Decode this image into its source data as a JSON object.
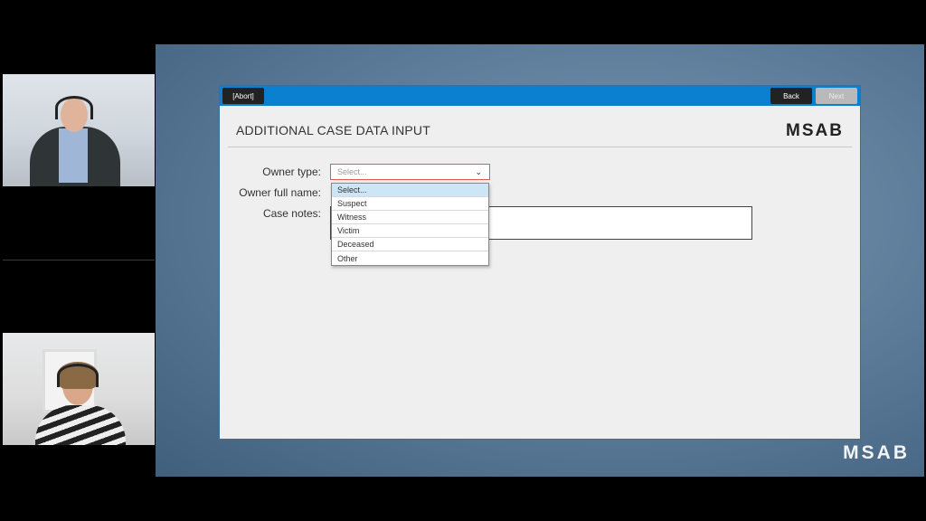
{
  "app": {
    "abort_label": "[Abort]",
    "back_label": "Back",
    "next_label": "Next",
    "title": "ADDITIONAL CASE DATA INPUT",
    "logo": "MSAB",
    "accent_color": "#0b7fd0"
  },
  "form": {
    "owner_type_label": "Owner type:",
    "owner_type_value": "Select...",
    "owner_name_label": "Owner full name:",
    "case_notes_label": "Case notes:",
    "owner_type_options": [
      {
        "label": "Select..."
      },
      {
        "label": "Suspect"
      },
      {
        "label": "Witness"
      },
      {
        "label": "Victim"
      },
      {
        "label": "Deceased"
      },
      {
        "label": "Other"
      }
    ]
  },
  "watermark": "MSAB"
}
